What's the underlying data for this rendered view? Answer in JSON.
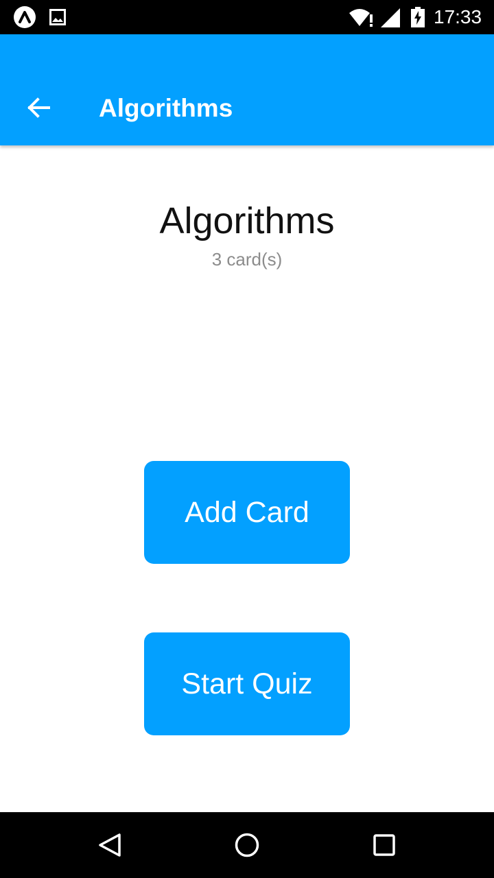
{
  "status_bar": {
    "time": "17:33",
    "icons": [
      "expo-icon",
      "gallery-icon",
      "wifi-alert-icon",
      "signal-icon",
      "battery-charging-icon"
    ]
  },
  "app_bar": {
    "back_icon": "arrow-left-icon",
    "title": "Algorithms"
  },
  "deck": {
    "title": "Algorithms",
    "count": "3 card(s)"
  },
  "actions": {
    "add_card": "Add Card",
    "start_quiz": "Start Quiz"
  },
  "nav_bar": {
    "icons": [
      "nav-back-icon",
      "nav-home-icon",
      "nav-recents-icon"
    ]
  },
  "colors": {
    "primary": "#03a0ff",
    "status_bar": "#000000",
    "subtitle": "#8c8c8c"
  }
}
